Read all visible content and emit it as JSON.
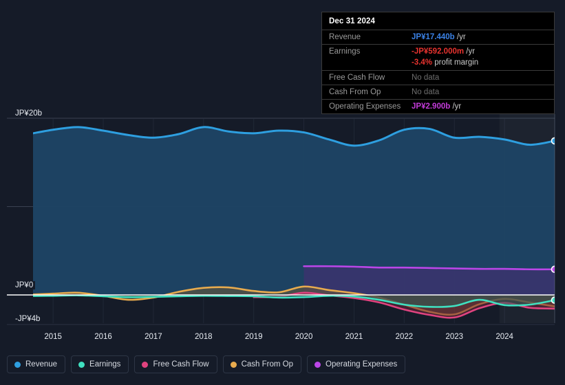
{
  "tooltip": {
    "date": "Dec 31 2024",
    "rows": [
      {
        "label": "Revenue",
        "value": "JP¥17.440b",
        "unit": "/yr",
        "color": "#3b82e6"
      },
      {
        "label": "Earnings",
        "value": "-JP¥592.000m",
        "unit": "/yr",
        "color": "#e8332f"
      },
      {
        "label": "",
        "value": "-3.4%",
        "unit": "profit margin",
        "color": "#e8332f"
      },
      {
        "label": "Free Cash Flow",
        "value": "No data",
        "unit": "",
        "color": "#6e6e6e"
      },
      {
        "label": "Cash From Op",
        "value": "No data",
        "unit": "",
        "color": "#6e6e6e"
      },
      {
        "label": "Operating Expenses",
        "value": "JP¥2.900b",
        "unit": "/yr",
        "color": "#c23bd8"
      }
    ]
  },
  "legend": {
    "items": [
      {
        "label": "Revenue",
        "color": "#2e9fe0"
      },
      {
        "label": "Earnings",
        "color": "#3fe0c0"
      },
      {
        "label": "Free Cash Flow",
        "color": "#e0437f"
      },
      {
        "label": "Cash From Op",
        "color": "#e8ab4e"
      },
      {
        "label": "Operating Expenses",
        "color": "#bb46e8"
      }
    ]
  },
  "axes": {
    "y_ticks": [
      {
        "label": "JP¥20b",
        "value": 20
      },
      {
        "label": "JP¥0",
        "value": 0
      },
      {
        "label": "-JP¥4b",
        "value": -4
      }
    ],
    "x_ticks": [
      "2015",
      "2016",
      "2017",
      "2018",
      "2019",
      "2020",
      "2021",
      "2022",
      "2023",
      "2024"
    ]
  },
  "chart_data": {
    "type": "area",
    "title": "",
    "xlabel": "",
    "ylabel": "JP¥",
    "ylim": [
      -4,
      20
    ],
    "xlim": [
      "2014.5",
      "2025.0"
    ],
    "grid": true,
    "legend_position": "bottom",
    "y_tick_values": [
      20,
      10,
      0,
      -4
    ],
    "y_tick_labels": [
      "JP¥20b",
      "",
      "JP¥0",
      "-JP¥4b"
    ],
    "x_tick_labels": [
      "2015",
      "2016",
      "2017",
      "2018",
      "2019",
      "2020",
      "2021",
      "2022",
      "2023",
      "2024"
    ],
    "currency": "JP¥",
    "units": "billions",
    "annotations": [
      {
        "text": "Dec 31 2024",
        "type": "tooltip-date"
      },
      {
        "text": "-3.4% profit margin",
        "type": "tooltip-note"
      }
    ],
    "series": [
      {
        "name": "Revenue",
        "color": "#2e9fe0",
        "fill": "#1d4465",
        "x": [
          2014.6,
          2015.0,
          2015.5,
          2016.0,
          2016.5,
          2017.0,
          2017.5,
          2018.0,
          2018.5,
          2019.0,
          2019.5,
          2020.0,
          2020.5,
          2021.0,
          2021.5,
          2022.0,
          2022.5,
          2023.0,
          2023.5,
          2024.0,
          2024.5,
          2025.0
        ],
        "values": [
          18.3,
          18.7,
          19.0,
          18.6,
          18.1,
          17.8,
          18.2,
          19.0,
          18.5,
          18.3,
          18.6,
          18.4,
          17.6,
          16.9,
          17.5,
          18.7,
          18.8,
          17.8,
          17.9,
          17.6,
          17.0,
          17.44
        ],
        "end_marker": true,
        "end_value": 17.44
      },
      {
        "name": "Earnings",
        "color": "#3fe0c0",
        "fill": "#2e5e58",
        "x": [
          2014.6,
          2015.0,
          2015.5,
          2016.0,
          2016.5,
          2017.0,
          2017.5,
          2018.0,
          2018.5,
          2019.0,
          2019.5,
          2020.0,
          2020.5,
          2021.0,
          2021.5,
          2022.0,
          2022.5,
          2023.0,
          2023.5,
          2024.0,
          2024.5,
          2025.0
        ],
        "values": [
          -0.12,
          -0.1,
          -0.05,
          -0.15,
          -0.25,
          -0.22,
          -0.15,
          -0.1,
          -0.12,
          -0.15,
          -0.3,
          -0.25,
          -0.1,
          -0.18,
          -0.55,
          -1.1,
          -1.35,
          -1.25,
          -0.55,
          -1.15,
          -1.1,
          -0.59
        ],
        "end_marker": true,
        "end_value": -0.592
      },
      {
        "name": "Free Cash Flow",
        "color": "#e0437f",
        "fill": "#6e2438",
        "x": [
          2019.0,
          2019.5,
          2020.0,
          2020.5,
          2021.0,
          2021.5,
          2022.0,
          2022.5,
          2023.0,
          2023.5,
          2024.0,
          2024.5,
          2025.0
        ],
        "values": [
          -0.25,
          -0.2,
          0.25,
          -0.05,
          -0.35,
          -0.85,
          -1.65,
          -2.25,
          -2.55,
          -1.5,
          -0.9,
          -1.45,
          -1.55
        ],
        "end_marker": false
      },
      {
        "name": "Cash From Op",
        "color": "#e8ab4e",
        "fill": "#6b5a34",
        "x": [
          2014.6,
          2015.0,
          2015.5,
          2016.0,
          2016.5,
          2017.0,
          2017.5,
          2018.0,
          2018.5,
          2019.0,
          2019.5,
          2020.0,
          2020.5,
          2021.0,
          2021.5,
          2022.0,
          2022.5,
          2023.0,
          2023.5,
          2024.0,
          2024.5,
          2025.0
        ],
        "values": [
          0.05,
          0.15,
          0.25,
          -0.1,
          -0.55,
          -0.3,
          0.35,
          0.8,
          0.85,
          0.45,
          0.3,
          0.95,
          0.55,
          0.2,
          -0.3,
          -1.1,
          -1.9,
          -2.2,
          -1.05,
          -0.45,
          -0.85,
          -1.3
        ],
        "end_marker": false
      },
      {
        "name": "Operating Expenses",
        "color": "#bb46e8",
        "fill": "#4a2c74",
        "x": [
          2020.0,
          2020.5,
          2021.0,
          2021.5,
          2022.0,
          2022.5,
          2023.0,
          2023.5,
          2024.0,
          2024.5,
          2025.0
        ],
        "values": [
          3.25,
          3.25,
          3.2,
          3.1,
          3.1,
          3.05,
          3.0,
          2.95,
          2.95,
          2.9,
          2.9
        ],
        "end_marker": true,
        "end_value": 2.9
      }
    ]
  }
}
